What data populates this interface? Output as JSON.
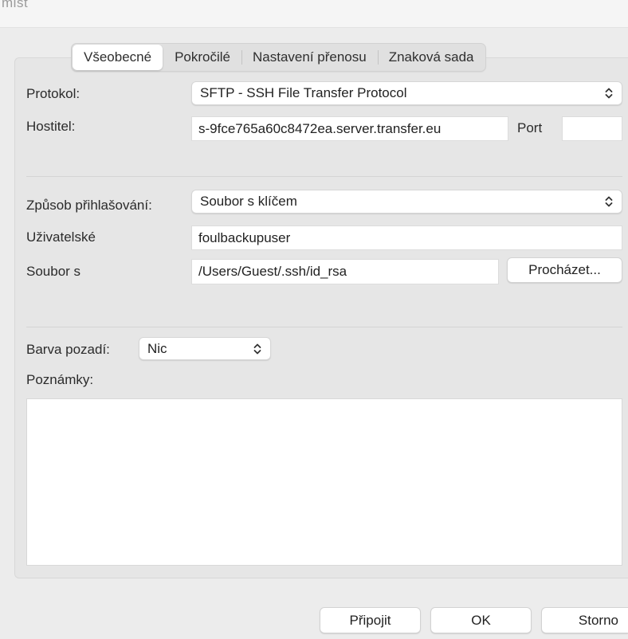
{
  "window": {
    "title": "mist"
  },
  "tabs": [
    {
      "label": "Všeobecné",
      "active": true
    },
    {
      "label": "Pokročilé",
      "active": false
    },
    {
      "label": "Nastavení přenosu",
      "active": false
    },
    {
      "label": "Znaková sada",
      "active": false
    }
  ],
  "form": {
    "protocol_label": "Protokol:",
    "protocol_value": "SFTP - SSH File Transfer Protocol",
    "host_label": "Hostitel:",
    "host_value": "s-9fce765a60c8472ea.server.transfer.eu",
    "port_label": "Port",
    "port_value": "",
    "login_method_label": "Způsob přihlašování:",
    "login_method_value": "Soubor s klíčem",
    "user_label": "Uživatelské",
    "user_value": "foulbackupuser",
    "keyfile_label": "Soubor s",
    "keyfile_value": "/Users/Guest/.ssh/id_rsa",
    "browse_label": "Procházet...",
    "bgcolor_label": "Barva pozadí:",
    "bgcolor_value": "Nic",
    "notes_label": "Poznámky:",
    "notes_value": ""
  },
  "footer": {
    "connect_label": "Připojit",
    "ok_label": "OK",
    "cancel_label": "Storno"
  },
  "icons": {
    "select_chevron": "chevron-up-down-icon"
  }
}
